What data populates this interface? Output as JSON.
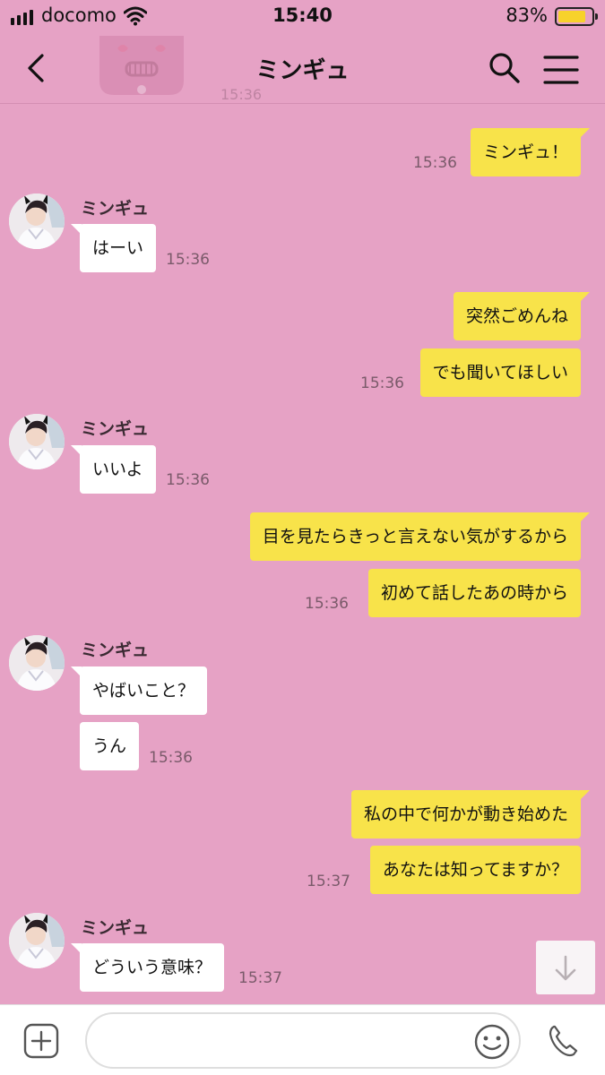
{
  "status_bar": {
    "carrier": "docomo",
    "time": "15:40",
    "battery_pct": "83%",
    "battery_level": 0.83,
    "signal_bars": 4
  },
  "header": {
    "title": "ミンギュ",
    "watermark_time": "15:36"
  },
  "contact": {
    "name": "ミンギュ"
  },
  "messages": [
    {
      "from": "me",
      "text": "ミンギュ！",
      "time": "15:36"
    },
    {
      "from": "them",
      "text": "はーい",
      "time": "15:36"
    },
    {
      "from": "me",
      "text": "突然ごめんね"
    },
    {
      "from": "me",
      "text": "でも聞いてほしい",
      "time": "15:36"
    },
    {
      "from": "them",
      "text": "いいよ",
      "time": "15:36"
    },
    {
      "from": "me",
      "text": "目を見たらきっと言えない気がするから"
    },
    {
      "from": "me",
      "text": "初めて話したあの時から",
      "time": "15:36"
    },
    {
      "from": "them",
      "text": "やばいこと？"
    },
    {
      "from": "them",
      "text": "うん",
      "time": "15:36"
    },
    {
      "from": "me",
      "text": "私の中で何かが動き始めた"
    },
    {
      "from": "me",
      "text": "あなたは知ってますか？",
      "time": "15:37"
    },
    {
      "from": "them",
      "text": "どういう意味？",
      "time": "15:37"
    }
  ],
  "input": {
    "placeholder": ""
  },
  "colors": {
    "background": "#e6a2c5",
    "my_bubble": "#f8e34a",
    "their_bubble": "#ffffff",
    "battery": "#f7d22b"
  },
  "icons": {
    "back": "chevron-left-icon",
    "search": "search-icon",
    "menu": "hamburger-menu-icon",
    "scroll_down": "arrow-down-icon",
    "add": "plus-box-icon",
    "emoji": "smiley-icon",
    "call": "phone-icon"
  }
}
